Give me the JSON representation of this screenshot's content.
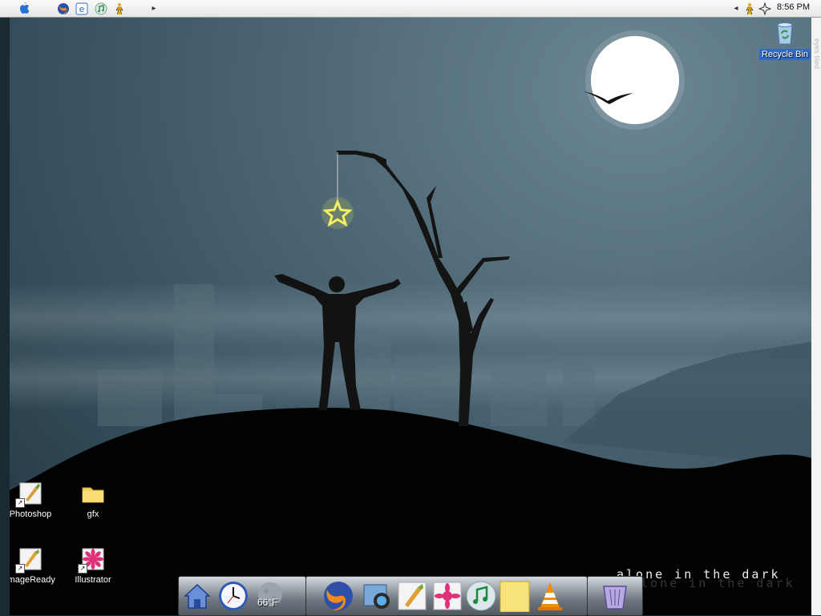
{
  "menubar": {
    "left_icons": [
      "apple-icon",
      "firefox-icon",
      "ie-icon",
      "itunes-icon",
      "aim-icon"
    ],
    "expand_glyph": "▸",
    "tray_icons": [
      "aim-tray-icon",
      "starburst-tray-icon"
    ],
    "collapse_glyph": "◂",
    "clock": "8:56 PM"
  },
  "desktop": {
    "recycle_bin": "Recycle Bin",
    "icons": [
      {
        "label": "Photoshop",
        "icon": "photoshop-icon",
        "shortcut": true
      },
      {
        "label": "gfx",
        "icon": "folder-icon",
        "shortcut": false
      },
      {
        "label": "imageReady",
        "icon": "imageready-icon",
        "shortcut": true
      },
      {
        "label": "Illustrator",
        "icon": "illustrator-icon",
        "shortcut": true
      }
    ],
    "wallpaper_text": "alone in the dark",
    "right_edge_text": "eyes tiled"
  },
  "dock": {
    "items": [
      "home-icon",
      "clock-widget-icon",
      "weather-widget-icon",
      "firefox-icon",
      "iphoto-icon",
      "imageready-icon",
      "illustrator-icon",
      "itunes-icon",
      "folder-icon",
      "vlc-icon",
      "trash-icon"
    ],
    "weather_temp": "66°F"
  },
  "colors": {
    "sky": "#4b6573",
    "moon": "#ffffff",
    "star": "#f0f060",
    "selection": "#316ac5"
  }
}
